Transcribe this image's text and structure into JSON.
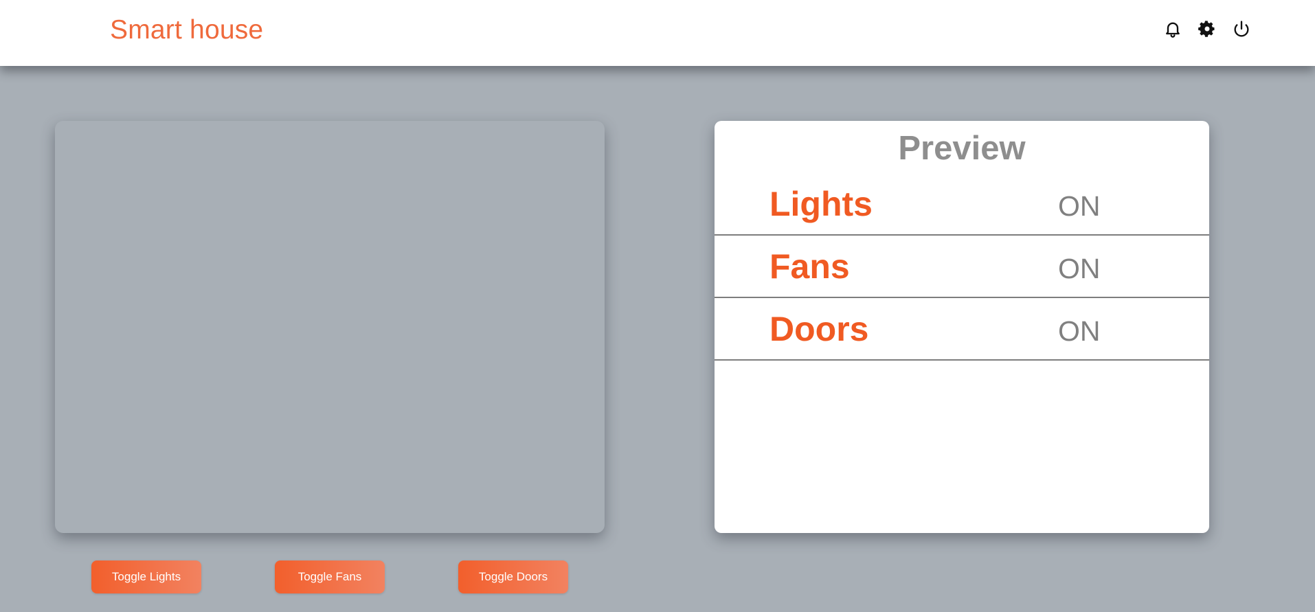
{
  "header": {
    "title": "Smart house",
    "icons": [
      "bell-icon",
      "gear-icon",
      "power-icon"
    ]
  },
  "preview": {
    "title": "Preview",
    "rows": [
      {
        "name": "Lights",
        "status": "ON"
      },
      {
        "name": "Fans",
        "status": "ON"
      },
      {
        "name": "Doors",
        "status": "ON"
      }
    ]
  },
  "controls": {
    "toggle_lights": "Toggle Lights",
    "toggle_fans": "Toggle Fans",
    "toggle_doors": "Toggle Doors"
  },
  "colors": {
    "accent": "#f05a22",
    "background": "#a8afb6",
    "status_text": "#808080"
  }
}
